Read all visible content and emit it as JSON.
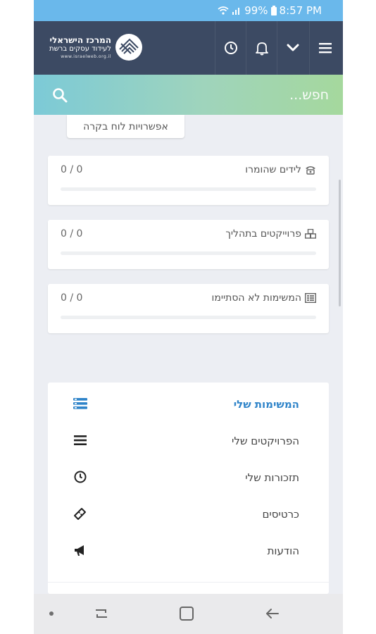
{
  "status_bar": {
    "battery": "99%",
    "time": "8:57 PM"
  },
  "header": {
    "logo_title": "המרכז הישראלי",
    "logo_subtitle": "לעידוד עסקים ברשת",
    "logo_url": "www.israelweb.org.il"
  },
  "search": {
    "placeholder": "חפש..."
  },
  "board_options_label": "אפשרויות לוח בקרה",
  "stats": [
    {
      "label": "לידים שהומרו",
      "count": "0 / 0",
      "progress": 0
    },
    {
      "label": "פרוייקטים בתהליך",
      "count": "0 / 0",
      "progress": 0
    },
    {
      "label": "המשימות לא הסתיימו",
      "count": "0 / 0",
      "progress": 0
    }
  ],
  "menu": [
    {
      "label": "המשימות שלי",
      "icon": "tasks-icon",
      "active": true
    },
    {
      "label": "הפרויקטים שלי",
      "icon": "list-icon",
      "active": false
    },
    {
      "label": "תזכורות שלי",
      "icon": "clock-icon",
      "active": false
    },
    {
      "label": "כרטיסים",
      "icon": "ticket-icon",
      "active": false
    },
    {
      "label": "הודעות",
      "icon": "megaphone-icon",
      "active": false
    }
  ],
  "colors": {
    "header": "#3c4a63",
    "status_bar": "#6ab8eb",
    "accent": "#2f84c9"
  }
}
